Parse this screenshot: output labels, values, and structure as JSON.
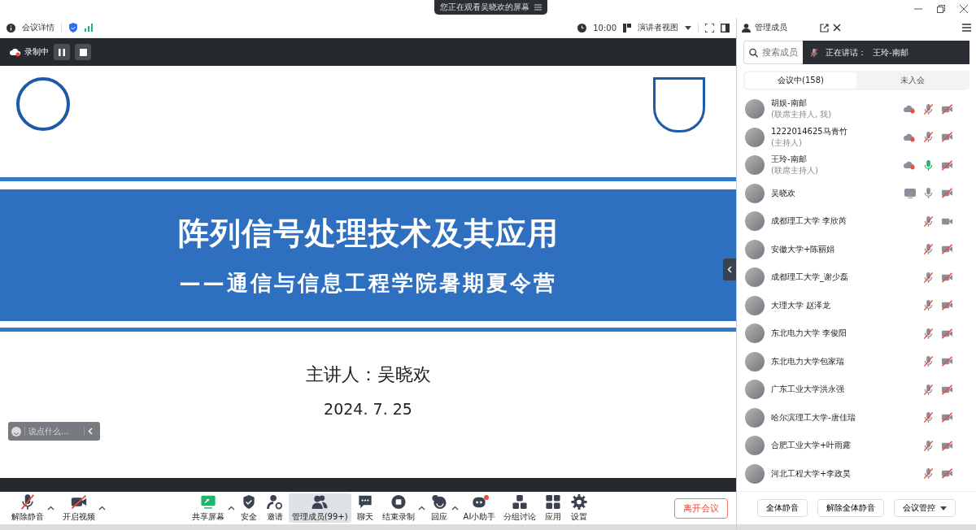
{
  "window": {
    "notice": "您正在观看吴晓欢的屏幕"
  },
  "meeting_bar": {
    "details": "会议详情",
    "duration": "10:00",
    "view": "演讲者视图"
  },
  "recording": {
    "label": "录制中"
  },
  "slide": {
    "title": "阵列信号处理技术及其应用",
    "subtitle": "——通信与信息工程学院暑期夏令营",
    "speaker": "主讲人：吴晓欢",
    "date": "2024. 7. 25"
  },
  "chat": {
    "placeholder": "说点什么..."
  },
  "toolbar": [
    {
      "kind": "mic",
      "label": "解除静音",
      "slashed": true,
      "caret": true,
      "selected": false
    },
    {
      "kind": "camera",
      "label": "开启视频",
      "slashed": true,
      "caret": true,
      "selected": false
    },
    {
      "kind": "share",
      "label": "共享屏幕",
      "caret": true,
      "selected": false
    },
    {
      "kind": "shield",
      "label": "安全",
      "selected": false
    },
    {
      "kind": "invite",
      "label": "邀请",
      "selected": false
    },
    {
      "kind": "members",
      "label": "管理成员(99+)",
      "selected": true
    },
    {
      "kind": "chat",
      "label": "聊天",
      "selected": false
    },
    {
      "kind": "record",
      "label": "结束录制",
      "caret": true,
      "selected": false
    },
    {
      "kind": "reaction",
      "label": "回应",
      "caret": true,
      "selected": false
    },
    {
      "kind": "ai",
      "label": "AI小助手",
      "selected": false,
      "badge": true
    },
    {
      "kind": "breakout",
      "label": "分组讨论",
      "selected": false
    },
    {
      "kind": "apps",
      "label": "应用",
      "selected": false
    },
    {
      "kind": "settings",
      "label": "设置",
      "selected": false
    }
  ],
  "leave_button": "离开会议",
  "panel": {
    "title": "管理成员",
    "search_placeholder": "搜索成员",
    "speaking": {
      "label": "正在讲话：",
      "name": "王玲-南邮"
    },
    "tabs": [
      {
        "label": "会议中(158)",
        "selected": true
      },
      {
        "label": "未入会",
        "selected": false
      }
    ],
    "members": [
      {
        "name": "胡娱-南邮",
        "role": "(联席主持人, 我)",
        "recording": true,
        "muted": true,
        "camera_on": false
      },
      {
        "name": "1222014625马青竹",
        "role": "(主持人)",
        "recording": true,
        "muted": true,
        "camera_on": false
      },
      {
        "name": "王玲-南邮",
        "role": "(联席主持人)",
        "recording": true,
        "muted": false,
        "speaking": true,
        "camera_on": false
      },
      {
        "name": "吴晓欢",
        "sharing": true,
        "muted": false,
        "camera_on": false
      },
      {
        "name": "成都理工大学 李欣芮",
        "muted": true,
        "camera_on": true
      },
      {
        "name": "安徽大学+陈丽娟",
        "muted": true,
        "camera_on": false
      },
      {
        "name": "成都理工大学_谢少磊",
        "muted": true,
        "camera_on": false
      },
      {
        "name": "大理大学 赵泽龙",
        "muted": true,
        "camera_on": false
      },
      {
        "name": "东北电力大学 李俊阳",
        "muted": true,
        "camera_on": false
      },
      {
        "name": "东北电力大学包家瑞",
        "muted": true,
        "camera_on": false
      },
      {
        "name": "广东工业大学洪永强",
        "muted": true,
        "camera_on": false
      },
      {
        "name": "哈尔滨理工大学-唐佳瑞",
        "muted": true,
        "camera_on": false
      },
      {
        "name": "合肥工业大学+叶雨露",
        "muted": true,
        "camera_on": false
      },
      {
        "name": "河北工程大学+李政昊",
        "muted": true,
        "camera_on": false
      }
    ],
    "buttons": [
      "全体静音",
      "解除全体静音",
      "会议管控"
    ]
  }
}
